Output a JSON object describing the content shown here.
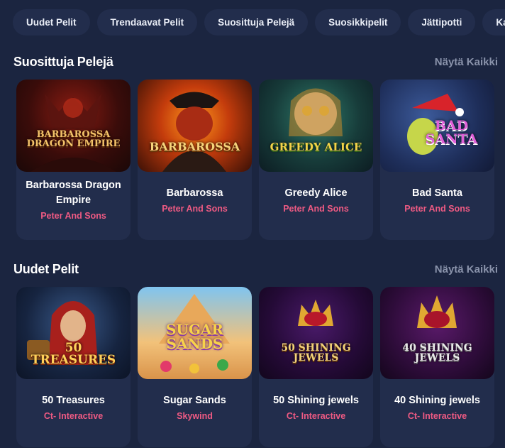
{
  "tabs": [
    "Uudet Pelit",
    "Trendaavat Pelit",
    "Suosittuja Pelejä",
    "Suosikkipelit",
    "Jättipotti",
    "Kaikki Kolikkopelit"
  ],
  "sections": [
    {
      "title": "Suosittuja Pelejä",
      "show_all": "Näytä Kaikki",
      "games": [
        {
          "title": "Barbarossa Dragon Empire",
          "provider": "Peter And Sons",
          "logo": "BARBAROSSA\nDRAGON EMPIRE"
        },
        {
          "title": "Barbarossa",
          "provider": "Peter And Sons",
          "logo": "BARBAROSSA"
        },
        {
          "title": "Greedy Alice",
          "provider": "Peter And Sons",
          "logo": "GREEDY ALICE"
        },
        {
          "title": "Bad Santa",
          "provider": "Peter And Sons",
          "logo": "BAD\nSANTA"
        }
      ]
    },
    {
      "title": "Uudet Pelit",
      "show_all": "Näytä Kaikki",
      "games": [
        {
          "title": "50 Treasures",
          "provider": "Ct- Interactive",
          "logo": "50\nTREASURES"
        },
        {
          "title": "Sugar Sands",
          "provider": "Skywind",
          "logo": "SUGAR\nSANDS"
        },
        {
          "title": "50 Shining jewels",
          "provider": "Ct- Interactive",
          "logo": "50 SHINING\nJEWELS"
        },
        {
          "title": "40 Shining jewels",
          "provider": "Ct- Interactive",
          "logo": "40 SHINING\nJEWELS"
        }
      ]
    }
  ],
  "colors": {
    "background": "#1b2540",
    "card": "#222d4c",
    "provider": "#ef5a83",
    "show_all": "#8a93ab"
  }
}
